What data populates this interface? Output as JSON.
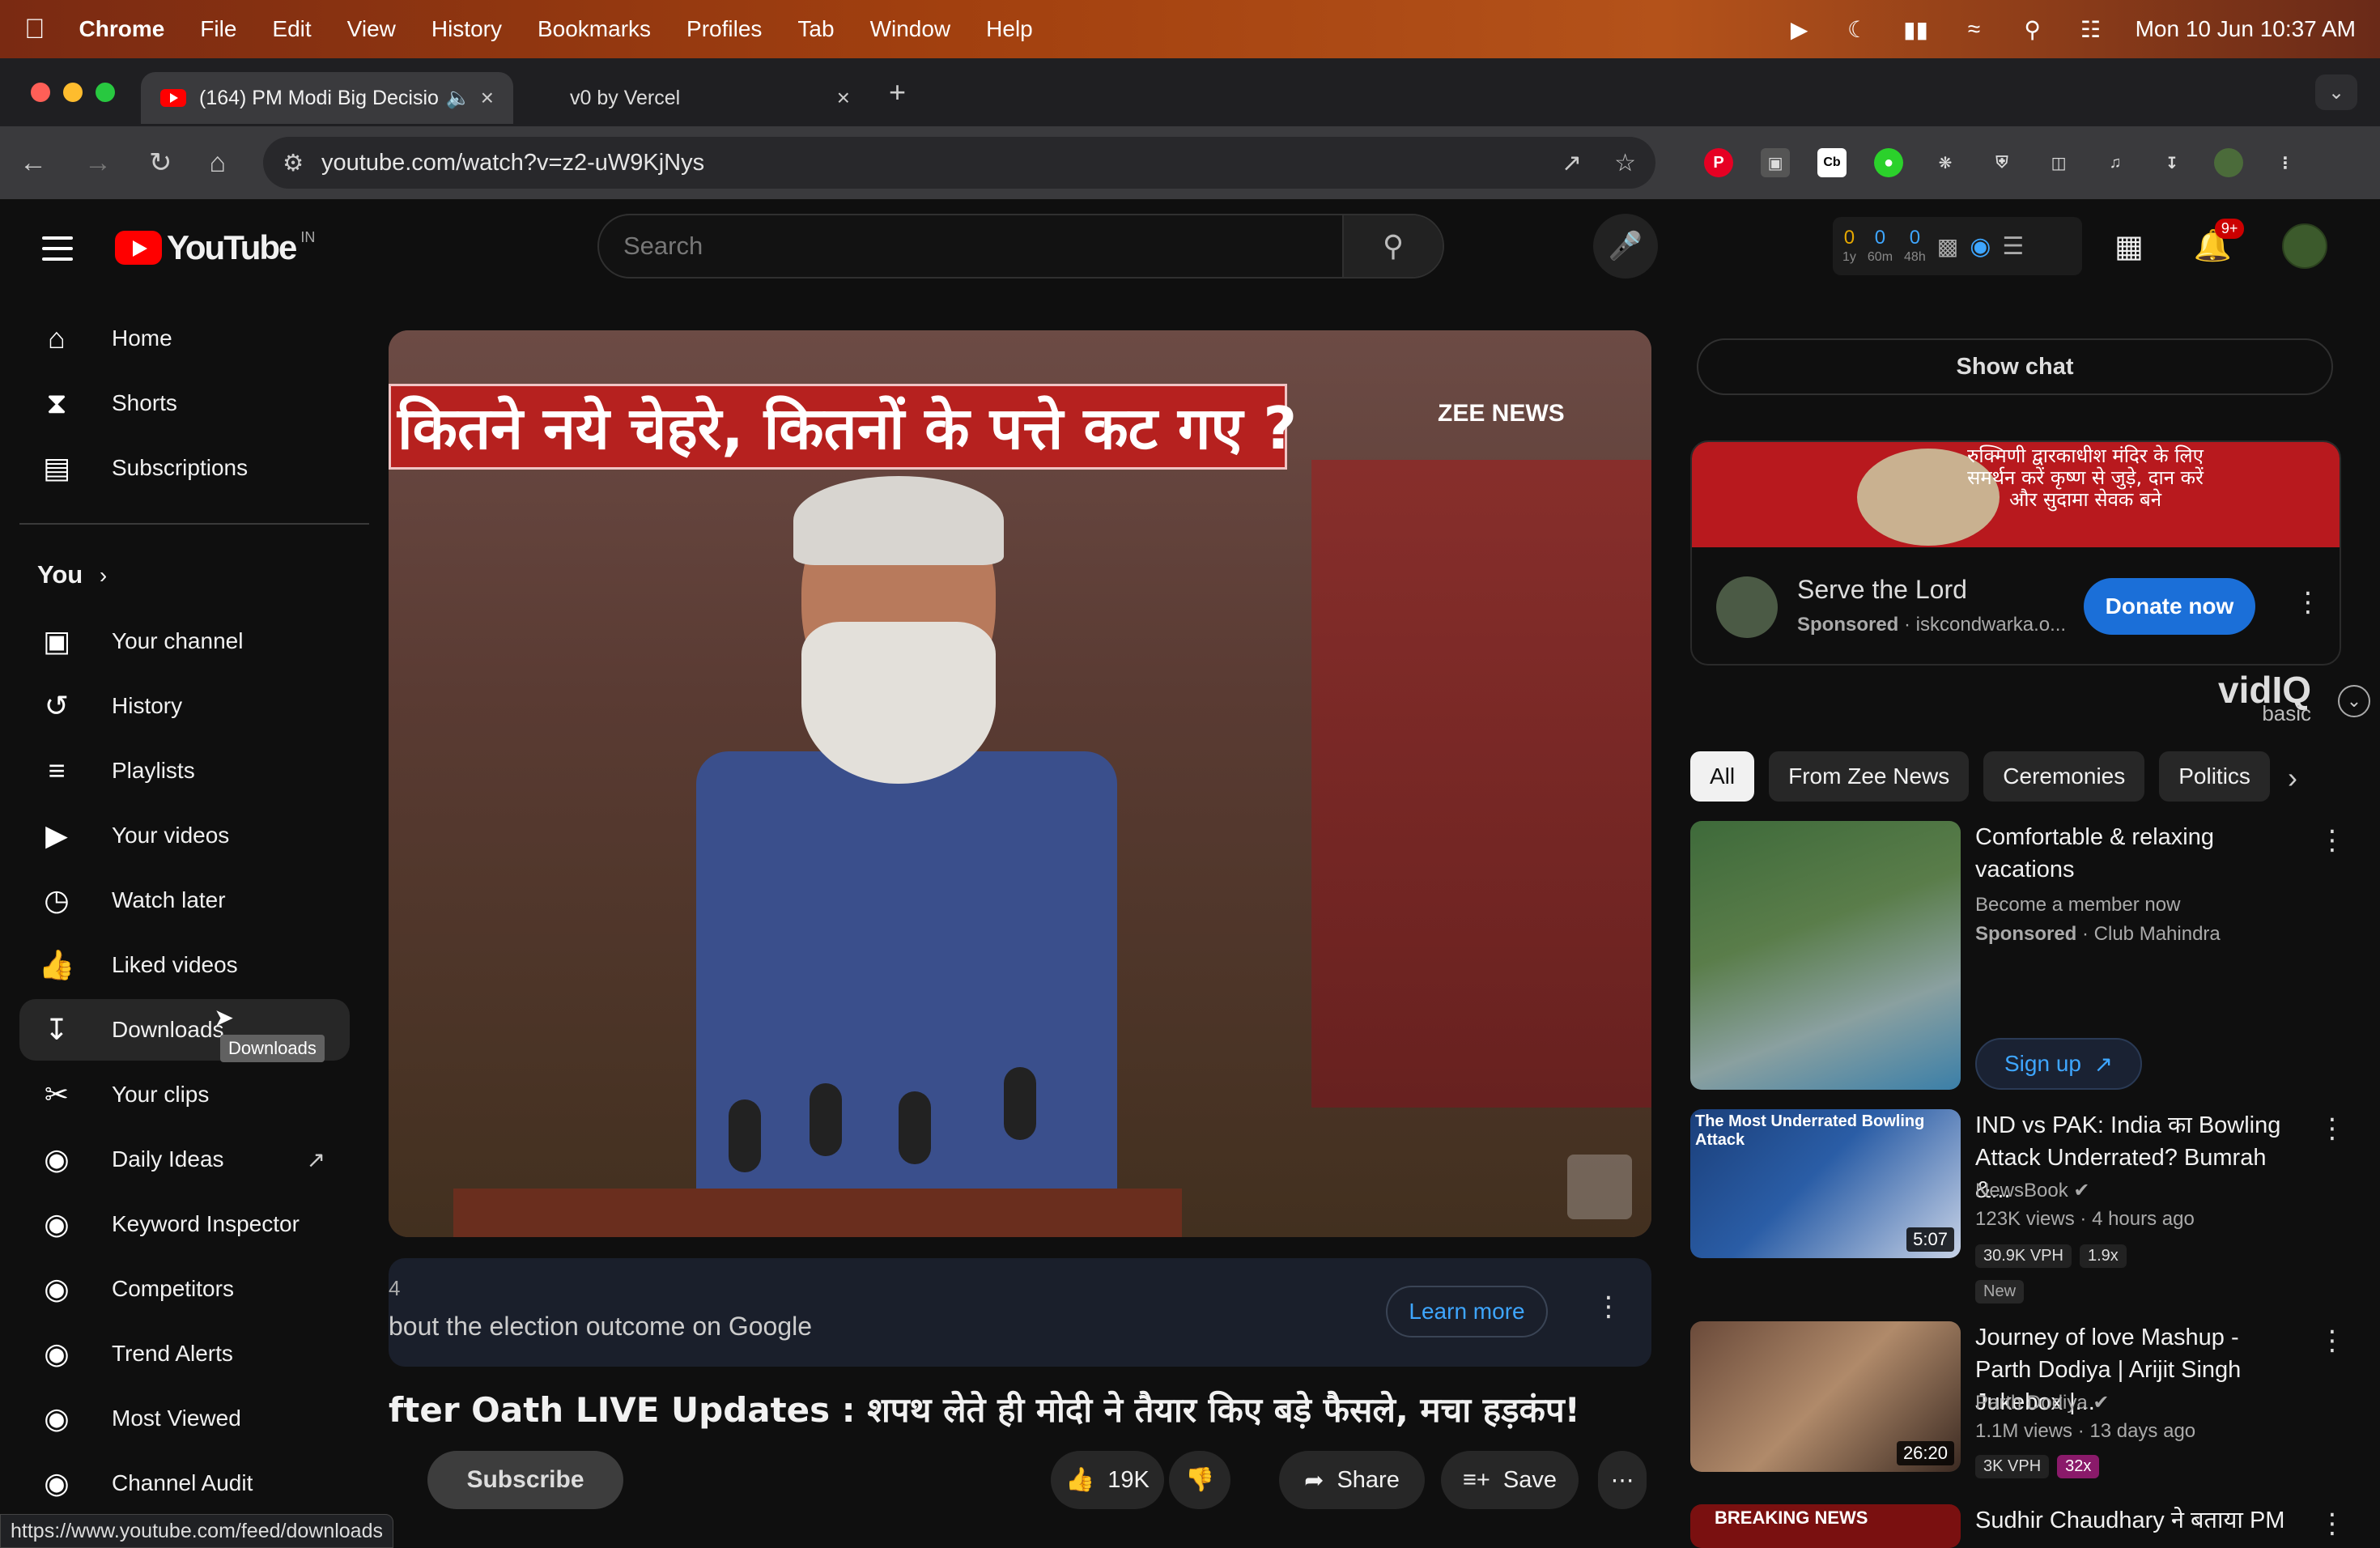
{
  "macos_menubar": {
    "app": "Chrome",
    "menus": [
      "File",
      "Edit",
      "View",
      "History",
      "Bookmarks",
      "Profiles",
      "Tab",
      "Window",
      "Help"
    ],
    "datetime": "Mon 10 Jun  10:37 AM"
  },
  "browser": {
    "tabs": [
      {
        "title": "(164) PM Modi Big Decisio",
        "active": true
      },
      {
        "title": "v0 by Vercel",
        "active": false
      }
    ],
    "url": "youtube.com/watch?v=z2-uW9KjNys",
    "status_url": "https://www.youtube.com/feed/downloads"
  },
  "youtube": {
    "logo_text": "YouTube",
    "country": "IN",
    "search_placeholder": "Search",
    "vidiq_counts": [
      {
        "value": "0",
        "label": "1y"
      },
      {
        "value": "0",
        "label": "60m"
      },
      {
        "value": "0",
        "label": "48h"
      }
    ],
    "notif_badge": "9+"
  },
  "sidebar": {
    "main": [
      {
        "label": "Home",
        "icon": "home-icon"
      },
      {
        "label": "Shorts",
        "icon": "shorts-icon"
      },
      {
        "label": "Subscriptions",
        "icon": "subscriptions-icon"
      }
    ],
    "you_label": "You",
    "you_items": [
      {
        "label": "Your channel",
        "icon": "channel-icon"
      },
      {
        "label": "History",
        "icon": "history-icon"
      },
      {
        "label": "Playlists",
        "icon": "playlists-icon"
      },
      {
        "label": "Your videos",
        "icon": "your-videos-icon"
      },
      {
        "label": "Watch later",
        "icon": "watch-later-icon"
      },
      {
        "label": "Liked videos",
        "icon": "like-icon"
      },
      {
        "label": "Downloads",
        "icon": "download-icon"
      },
      {
        "label": "Your clips",
        "icon": "clips-icon"
      },
      {
        "label": "Daily Ideas",
        "icon": "vidiq-icon"
      },
      {
        "label": "Keyword Inspector",
        "icon": "vidiq-icon"
      },
      {
        "label": "Competitors",
        "icon": "vidiq-icon"
      },
      {
        "label": "Trend Alerts",
        "icon": "vidiq-icon"
      },
      {
        "label": "Most Viewed",
        "icon": "vidiq-icon"
      },
      {
        "label": "Channel Audit",
        "icon": "vidiq-icon"
      }
    ],
    "tooltip": "Downloads"
  },
  "video": {
    "overlay_text": "कितने नये चेहरे, कितनों के पत्ते कट गए ?",
    "channel_bug": "ZEE NEWS",
    "ad_small": "4",
    "ad_text": "bout the election outcome on Google",
    "learn_more": "Learn more",
    "title": "fter Oath LIVE Updates : शपथ लेते ही मोदी ने तैयार किए बड़े फैसले, मचा हड़कंप!",
    "subscribe": "Subscribe",
    "likes": "19K",
    "share": "Share",
    "save": "Save"
  },
  "right": {
    "show_chat": "Show chat",
    "ad": {
      "banner_text": "रुक्मिणी द्वारकाधीश मंदिर के लिए समर्थन करें कृष्ण से जुड़े, दान करें और सुदामा सेवक बने",
      "name": "Serve the Lord",
      "sponsored": "Sponsored",
      "domain": "iskcondwarka.o...",
      "cta": "Donate now"
    },
    "vidiq": {
      "brand": "vidIQ",
      "plan": "basic"
    },
    "chips": [
      "All",
      "From Zee News",
      "Ceremonies",
      "Politics"
    ],
    "videos": [
      {
        "title": "Comfortable & relaxing vacations",
        "line2": "Become a member now",
        "sponsored": "Sponsored",
        "channel": "Club Mahindra",
        "cta": "Sign up"
      },
      {
        "thumb_text": "The Most Underrated Bowling Attack",
        "title": "IND vs PAK: India का Bowling Attack Underrated? Bumrah &...",
        "channel": "NewsBook",
        "views": "123K views",
        "age": "4 hours ago",
        "vph": "30.9K VPH",
        "mult": "1.9x",
        "badge": "New",
        "duration": "5:07"
      },
      {
        "title": "Journey of love Mashup - Parth Dodiya | Arijit Singh Jukebox |...",
        "channel": "Parth Dodiya",
        "views": "1.1M views",
        "age": "13 days ago",
        "vph": "3K VPH",
        "mult": "32x",
        "duration": "26:20"
      },
      {
        "thumb_text": "BREAKING NEWS",
        "title": "Sudhir Chaudhary ने बताया PM"
      }
    ]
  }
}
